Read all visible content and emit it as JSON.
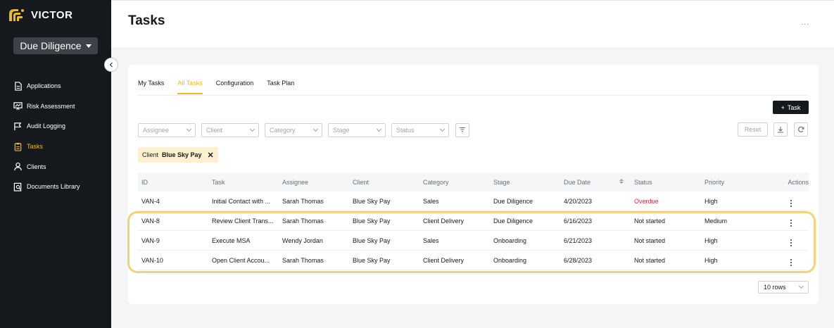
{
  "app": {
    "logo_text": "VICTOR",
    "workspace": "Due Diligence"
  },
  "sidebar": {
    "items": [
      {
        "label": "Applications",
        "icon": "document-icon"
      },
      {
        "label": "Risk Assessment",
        "icon": "chart-monitor-icon"
      },
      {
        "label": "Audit Logging",
        "icon": "flag-icon"
      },
      {
        "label": "Tasks",
        "icon": "clipboard-icon",
        "active": true
      },
      {
        "label": "Clients",
        "icon": "user-icon"
      },
      {
        "label": "Documents Library",
        "icon": "search-document-icon"
      }
    ]
  },
  "header": {
    "title": "Tasks",
    "more": "..."
  },
  "tabs": [
    "My Tasks",
    "All Tasks",
    "Configuration",
    "Task Plan"
  ],
  "toolbar": {
    "add_task": "Task",
    "reset": "Reset"
  },
  "filters": {
    "assignee": "Assignee",
    "client": "Client",
    "category": "Category",
    "stage": "Stage",
    "status": "Status"
  },
  "chip": {
    "label": "Client",
    "value": "Blue Sky Pay"
  },
  "table": {
    "headers": [
      "ID",
      "Task",
      "Assignee",
      "Client",
      "Category",
      "Stage",
      "Due Date",
      "Status",
      "Priority",
      "Actions"
    ],
    "rows": [
      [
        "VAN-4",
        "Initial Contact with ...",
        "Sarah Thomas",
        "Blue Sky Pay",
        "Sales",
        "Due Diligence",
        "4/20/2023",
        "Overdue",
        "High"
      ],
      [
        "VAN-8",
        "Review Client Trans...",
        "Sarah Thomas",
        "Blue Sky Pay",
        "Client Delivery",
        "Due Diligence",
        "6/16/2023",
        "Not started",
        "Medium"
      ],
      [
        "VAN-9",
        "Execute MSA",
        "Wendy Jordan",
        "Blue Sky Pay",
        "Sales",
        "Onboarding",
        "6/21/2023",
        "Not started",
        "High"
      ],
      [
        "VAN-10",
        "Open Client Accou...",
        "Sarah Thomas",
        "Blue Sky Pay",
        "Client Delivery",
        "Onboarding",
        "6/28/2023",
        "Not started",
        "High"
      ]
    ]
  },
  "pagination": {
    "rows_per_page": "10 rows"
  },
  "colors": {
    "accent": "#f0b91c",
    "sidebar_bg": "#15191d",
    "overdue": "#d92d3a"
  }
}
